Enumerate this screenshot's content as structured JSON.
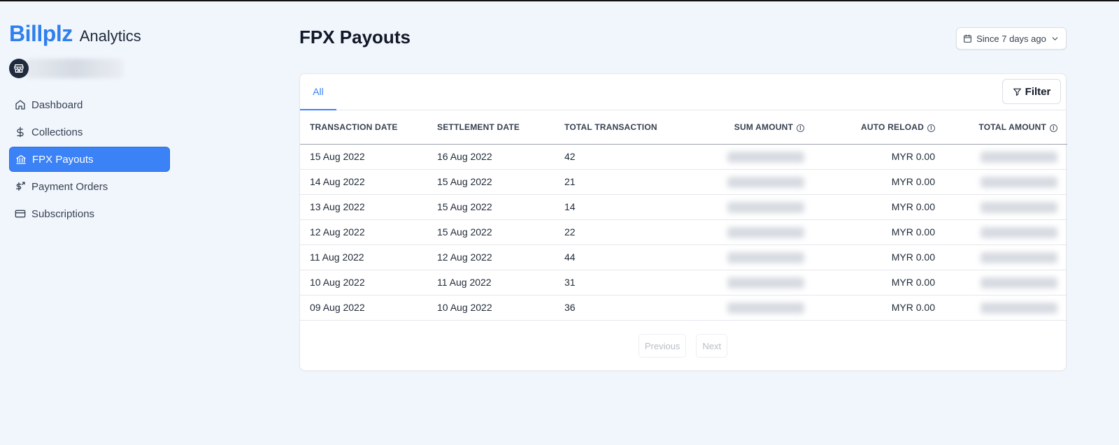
{
  "brand": {
    "name": "Billplz",
    "subtitle": "Analytics"
  },
  "sidebar": {
    "items": [
      {
        "label": "Dashboard",
        "icon": "home-icon",
        "active": false
      },
      {
        "label": "Collections",
        "icon": "dollar-icon",
        "active": false
      },
      {
        "label": "FPX Payouts",
        "icon": "bank-icon",
        "active": true
      },
      {
        "label": "Payment Orders",
        "icon": "dollar-transfer-icon",
        "active": false
      },
      {
        "label": "Subscriptions",
        "icon": "credit-card-icon",
        "active": false
      }
    ]
  },
  "header": {
    "title": "FPX Payouts",
    "date_range": "Since 7 days ago"
  },
  "tabs": [
    {
      "label": "All",
      "active": true
    }
  ],
  "filter_label": "Filter",
  "table": {
    "columns": [
      "TRANSACTION DATE",
      "SETTLEMENT DATE",
      "TOTAL TRANSACTION",
      "SUM AMOUNT",
      "AUTO RELOAD",
      "TOTAL AMOUNT"
    ],
    "rows": [
      [
        "15 Aug 2022",
        "16 Aug 2022",
        "42",
        "",
        "MYR 0.00",
        ""
      ],
      [
        "14 Aug 2022",
        "15 Aug 2022",
        "21",
        "",
        "MYR 0.00",
        ""
      ],
      [
        "13 Aug 2022",
        "15 Aug 2022",
        "14",
        "",
        "MYR 0.00",
        ""
      ],
      [
        "12 Aug 2022",
        "15 Aug 2022",
        "22",
        "",
        "MYR 0.00",
        ""
      ],
      [
        "11 Aug 2022",
        "12 Aug 2022",
        "44",
        "",
        "MYR 0.00",
        ""
      ],
      [
        "10 Aug 2022",
        "11 Aug 2022",
        "31",
        "",
        "MYR 0.00",
        ""
      ],
      [
        "09 Aug 2022",
        "10 Aug 2022",
        "36",
        "",
        "MYR 0.00",
        ""
      ]
    ]
  },
  "pagination": {
    "previous": "Previous",
    "next": "Next"
  },
  "colors": {
    "accent": "#3b82f6",
    "brand": "#2f80ed",
    "background": "#f1f6fd"
  }
}
